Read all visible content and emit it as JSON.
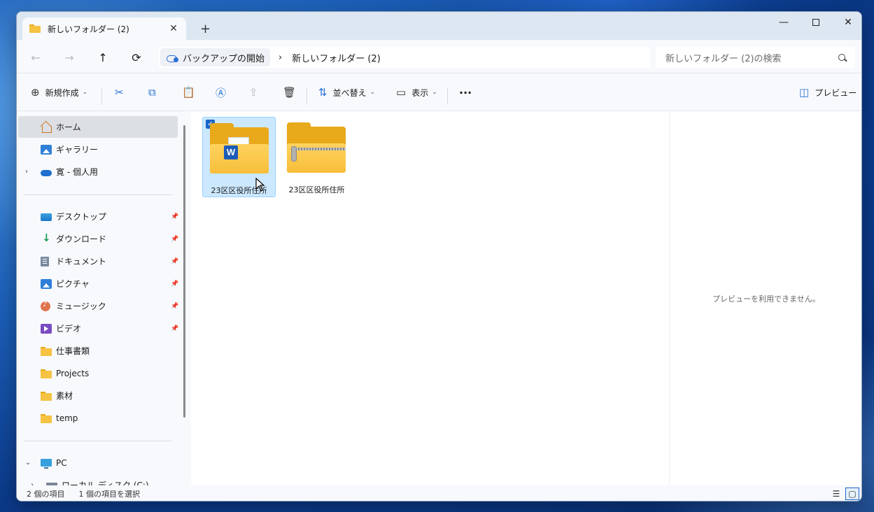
{
  "window": {
    "tab_title": "新しいフォルダー (2)",
    "tab_close": "✕",
    "new_tab": "+",
    "minimize": "—",
    "close": "✕"
  },
  "address": {
    "back": "←",
    "forward": "→",
    "up": "↑",
    "refresh": "⟳",
    "crumbs": [
      "バックアップの開始",
      "新しいフォルダー (2)"
    ],
    "separator": "›",
    "search_placeholder": "新しいフォルダー (2)の検索"
  },
  "toolbar": {
    "new": "新規作成",
    "new_icon": "⊕",
    "cut_icon": "✂",
    "copy_icon": "⧉",
    "paste_icon": "📋",
    "rename_icon": "Ⓐ",
    "share_icon": "⇪",
    "delete_icon": "🗑",
    "sort": "並べ替え",
    "sort_icon": "⇅",
    "view": "表示",
    "view_icon": "▭",
    "more": "···",
    "preview": "プレビュー",
    "preview_icon": "◫",
    "chevron": "⌄"
  },
  "nav": {
    "items": [
      {
        "label": "ホーム",
        "icon": "home-icon"
      },
      {
        "label": "ギャラリー",
        "icon": "gallery-icon"
      },
      {
        "label": "寛 - 個人用",
        "icon": "onedrive-icon"
      }
    ],
    "quick": [
      {
        "label": "デスクトップ",
        "icon": "desktop-icon",
        "pinned": true
      },
      {
        "label": "ダウンロード",
        "icon": "download-icon",
        "pinned": true
      },
      {
        "label": "ドキュメント",
        "icon": "document-icon",
        "pinned": true
      },
      {
        "label": "ピクチャ",
        "icon": "pictures-icon",
        "pinned": true
      },
      {
        "label": "ミュージック",
        "icon": "music-icon",
        "pinned": true
      },
      {
        "label": "ビデオ",
        "icon": "video-icon",
        "pinned": true
      },
      {
        "label": "仕事書類",
        "icon": "folder-icon"
      },
      {
        "label": "Projects",
        "icon": "folder-icon"
      },
      {
        "label": "素材",
        "icon": "folder-icon"
      },
      {
        "label": "temp",
        "icon": "folder-icon"
      }
    ],
    "pc": {
      "label": "PC",
      "icon": "pc-icon"
    },
    "drive": {
      "label": "ローカル ディスク (C:)",
      "icon": "drive-icon"
    },
    "expand_closed": "›",
    "expand_open": "⌄",
    "pin": "📌"
  },
  "files": [
    {
      "name": "23区区役所住所",
      "type": "word-folder",
      "selected": true
    },
    {
      "name": "23区区役所住所",
      "type": "zip-folder",
      "selected": false
    }
  ],
  "preview": {
    "message": "プレビューを利用できません。"
  },
  "status": {
    "count": "2 個の項目",
    "selected": "1 個の項目を選択",
    "details_icon": "☰",
    "tiles_icon": "▢"
  },
  "colors": {
    "accent": "#1a64c8",
    "selection": "#cce8ff",
    "folder": "#f5c242"
  }
}
